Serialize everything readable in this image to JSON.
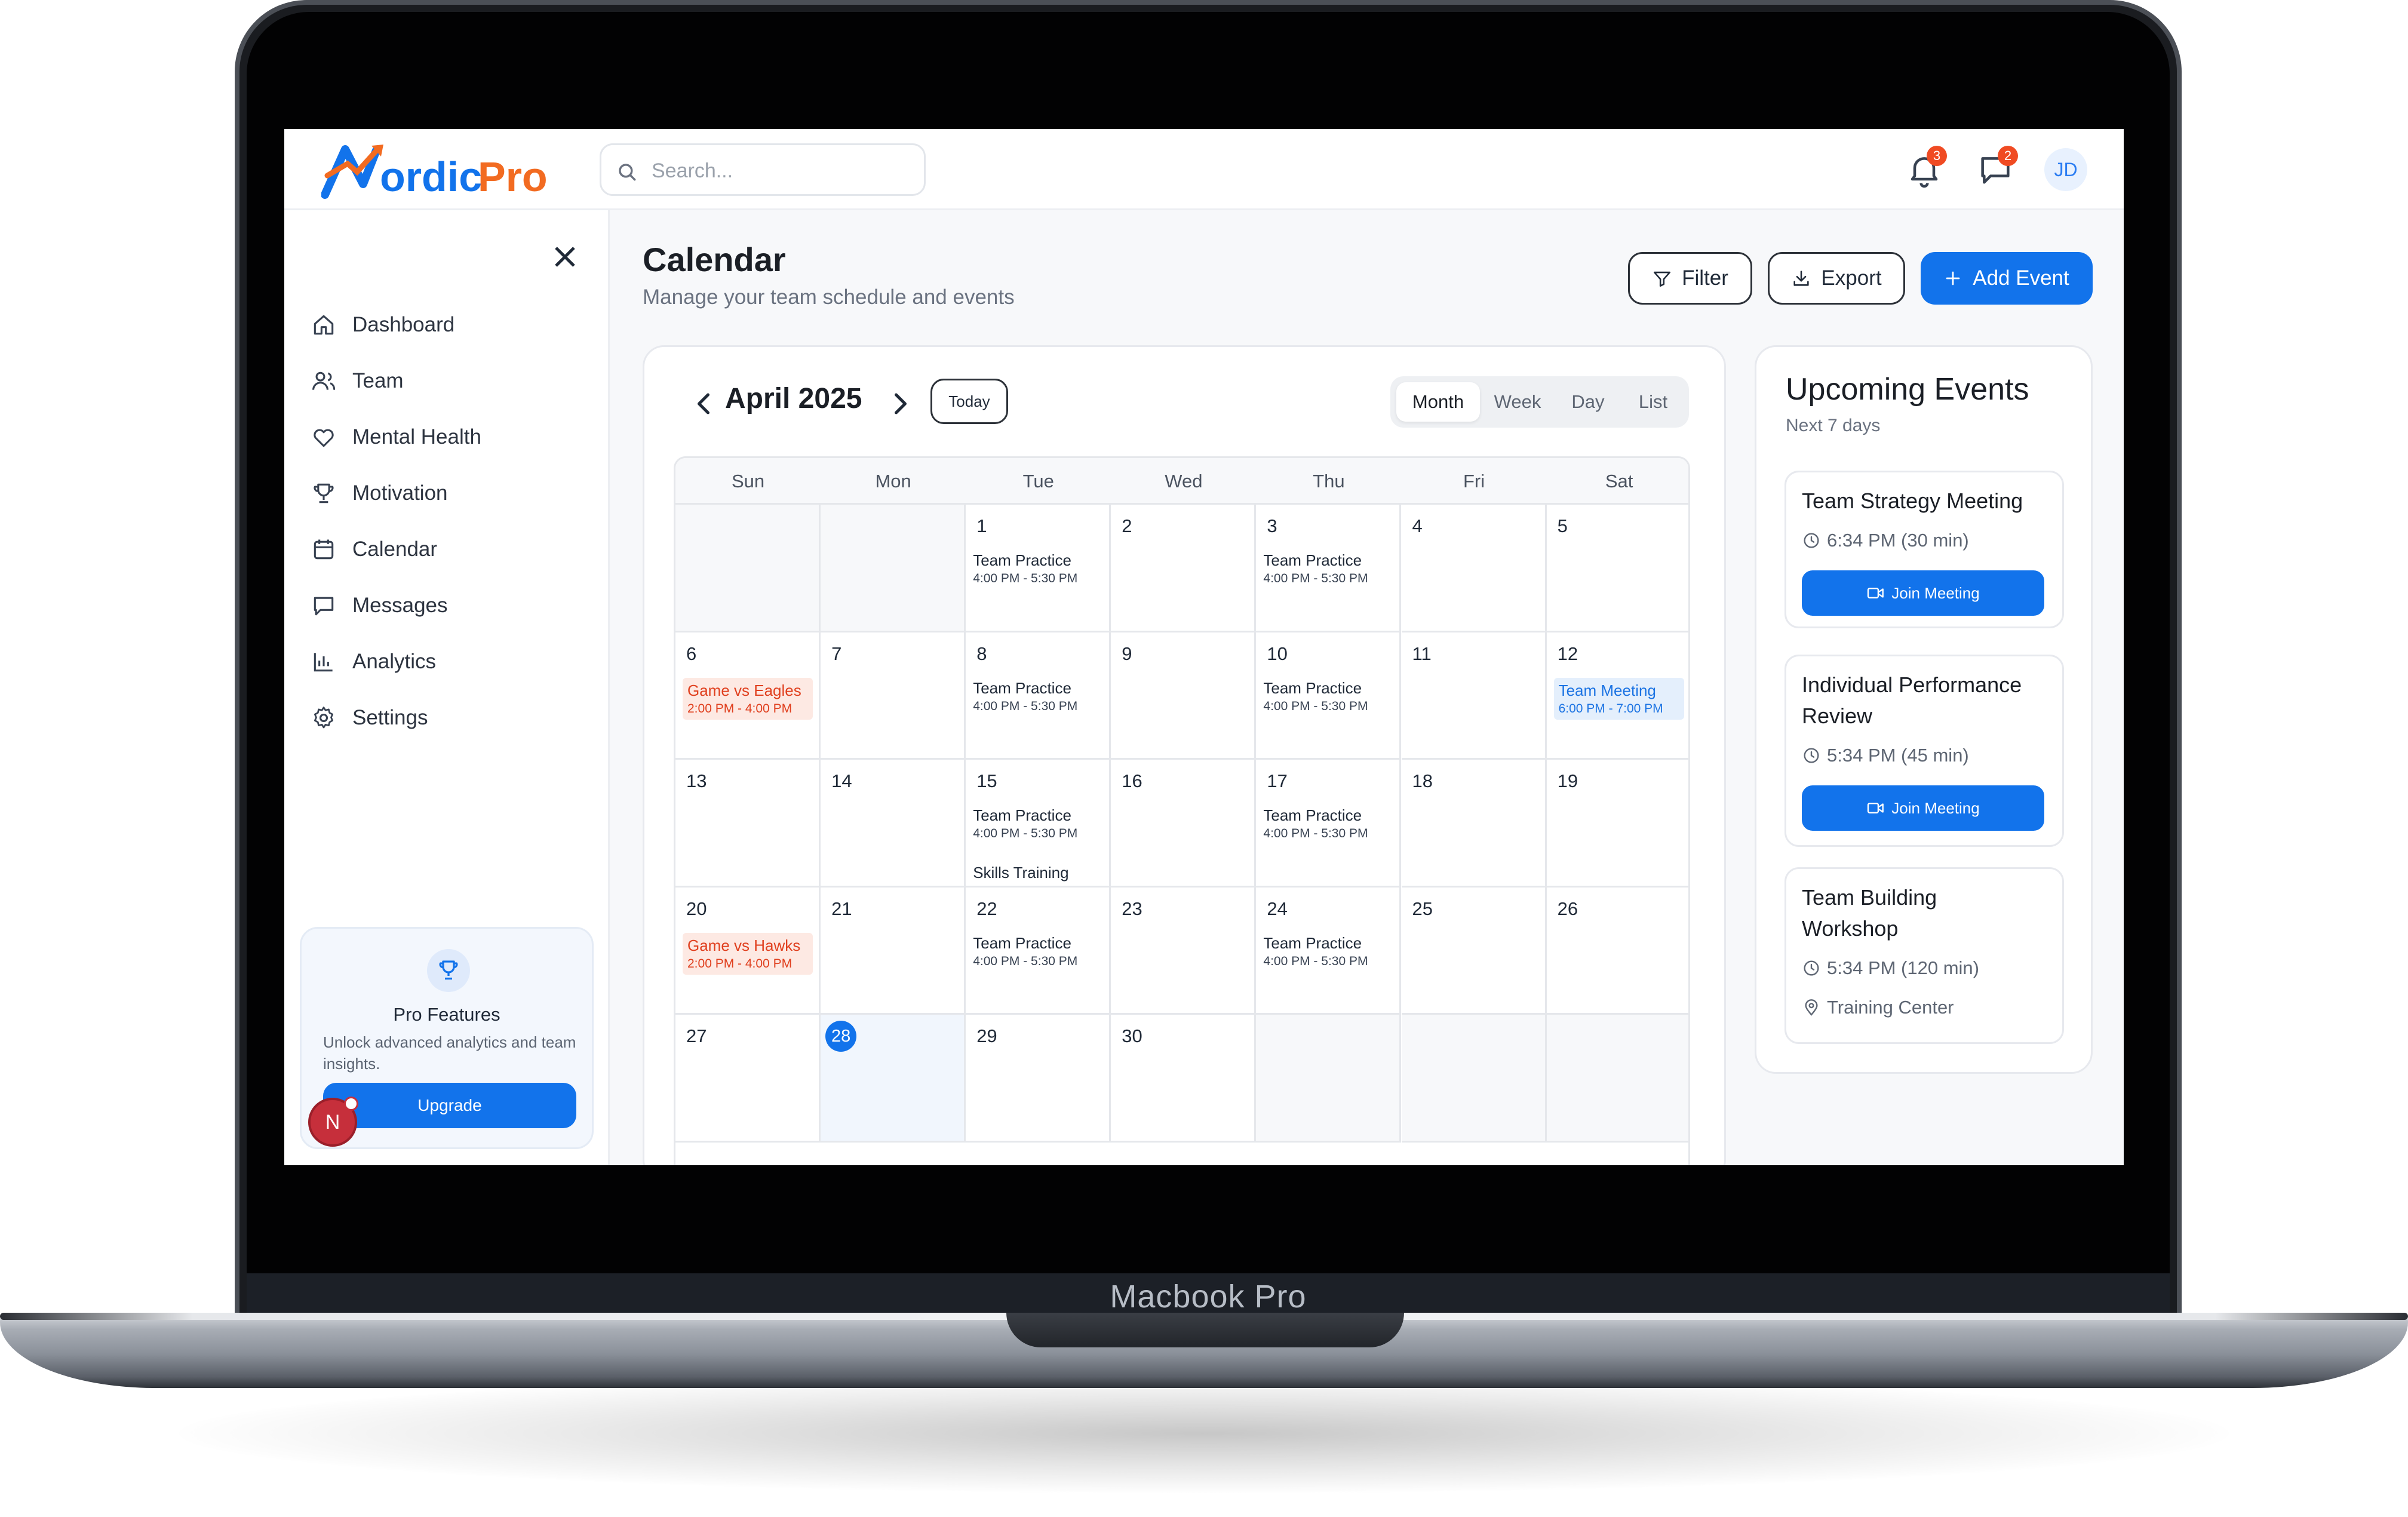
{
  "device": {
    "label": "Macbook Pro"
  },
  "brand": {
    "name": "NordicPro",
    "accent": "#1273eb",
    "logo_orange": "#f26b21"
  },
  "search": {
    "placeholder": "Search..."
  },
  "notifications": {
    "bell_count": "3",
    "messages_count": "2"
  },
  "user": {
    "initials": "JD"
  },
  "sidebar": {
    "items": [
      {
        "label": "Dashboard",
        "icon": "home-icon"
      },
      {
        "label": "Team",
        "icon": "users-icon"
      },
      {
        "label": "Mental Health",
        "icon": "heart-icon"
      },
      {
        "label": "Motivation",
        "icon": "trophy-icon"
      },
      {
        "label": "Calendar",
        "icon": "calendar-icon"
      },
      {
        "label": "Messages",
        "icon": "message-icon"
      },
      {
        "label": "Analytics",
        "icon": "bar-chart-icon"
      },
      {
        "label": "Settings",
        "icon": "gear-icon"
      }
    ],
    "pro": {
      "title": "Pro Features",
      "text": "Unlock advanced analytics and team insights.",
      "button": "Upgrade"
    },
    "fab": "N"
  },
  "page": {
    "title": "Calendar",
    "subtitle": "Manage your team schedule and events",
    "filter": "Filter",
    "export": "Export",
    "add_event": "Add Event"
  },
  "calendar": {
    "month_label": "April 2025",
    "today_label": "Today",
    "views": [
      "Month",
      "Week",
      "Day",
      "List"
    ],
    "active_view": "Month",
    "weekdays": [
      "Sun",
      "Mon",
      "Tue",
      "Wed",
      "Thu",
      "Fri",
      "Sat"
    ],
    "today": "28",
    "weeks": [
      [
        {
          "day": "",
          "events": []
        },
        {
          "day": "",
          "events": []
        },
        {
          "day": "1",
          "events": [
            {
              "title": "Team Practice",
              "time": "4:00 PM - 5:30 PM",
              "kind": "plain"
            }
          ]
        },
        {
          "day": "2",
          "events": []
        },
        {
          "day": "3",
          "events": [
            {
              "title": "Team Practice",
              "time": "4:00 PM - 5:30 PM",
              "kind": "plain"
            }
          ]
        },
        {
          "day": "4",
          "events": []
        },
        {
          "day": "5",
          "events": []
        }
      ],
      [
        {
          "day": "6",
          "events": [
            {
              "title": "Game vs Eagles",
              "time": "2:00 PM - 4:00 PM",
              "kind": "game"
            }
          ]
        },
        {
          "day": "7",
          "events": []
        },
        {
          "day": "8",
          "events": [
            {
              "title": "Team Practice",
              "time": "4:00 PM - 5:30 PM",
              "kind": "plain"
            }
          ]
        },
        {
          "day": "9",
          "events": []
        },
        {
          "day": "10",
          "events": [
            {
              "title": "Team Practice",
              "time": "4:00 PM - 5:30 PM",
              "kind": "plain"
            }
          ]
        },
        {
          "day": "11",
          "events": []
        },
        {
          "day": "12",
          "events": [
            {
              "title": "Team Meeting",
              "time": "6:00 PM - 7:00 PM",
              "kind": "meeting"
            }
          ]
        }
      ],
      [
        {
          "day": "13",
          "events": []
        },
        {
          "day": "14",
          "events": []
        },
        {
          "day": "15",
          "events": [
            {
              "title": "Team Practice",
              "time": "4:00 PM - 5:30 PM",
              "kind": "plain"
            },
            {
              "title": "Skills Training",
              "time": "",
              "kind": "plain"
            }
          ]
        },
        {
          "day": "16",
          "events": []
        },
        {
          "day": "17",
          "events": [
            {
              "title": "Team Practice",
              "time": "4:00 PM - 5:30 PM",
              "kind": "plain"
            }
          ]
        },
        {
          "day": "18",
          "events": []
        },
        {
          "day": "19",
          "events": []
        }
      ],
      [
        {
          "day": "20",
          "events": [
            {
              "title": "Game vs Hawks",
              "time": "2:00 PM - 4:00 PM",
              "kind": "game"
            }
          ]
        },
        {
          "day": "21",
          "events": []
        },
        {
          "day": "22",
          "events": [
            {
              "title": "Team Practice",
              "time": "4:00 PM - 5:30 PM",
              "kind": "plain"
            }
          ]
        },
        {
          "day": "23",
          "events": []
        },
        {
          "day": "24",
          "events": [
            {
              "title": "Team Practice",
              "time": "4:00 PM - 5:30 PM",
              "kind": "plain"
            }
          ]
        },
        {
          "day": "25",
          "events": []
        },
        {
          "day": "26",
          "events": []
        }
      ],
      [
        {
          "day": "27",
          "events": []
        },
        {
          "day": "28",
          "events": []
        },
        {
          "day": "29",
          "events": []
        },
        {
          "day": "30",
          "events": []
        },
        {
          "day": "",
          "events": []
        },
        {
          "day": "",
          "events": []
        },
        {
          "day": "",
          "events": []
        }
      ]
    ]
  },
  "upcoming": {
    "title": "Upcoming Events",
    "subtitle": "Next 7 days",
    "join_label": "Join Meeting",
    "events": [
      {
        "name": "Team Strategy Meeting",
        "time": "6:34 PM (30 min)"
      },
      {
        "name": "Individual Performance Review",
        "time": "5:34 PM (45 min)"
      },
      {
        "name": "Team Building Workshop",
        "time": "5:34 PM (120 min)",
        "location": "Training Center"
      }
    ]
  }
}
